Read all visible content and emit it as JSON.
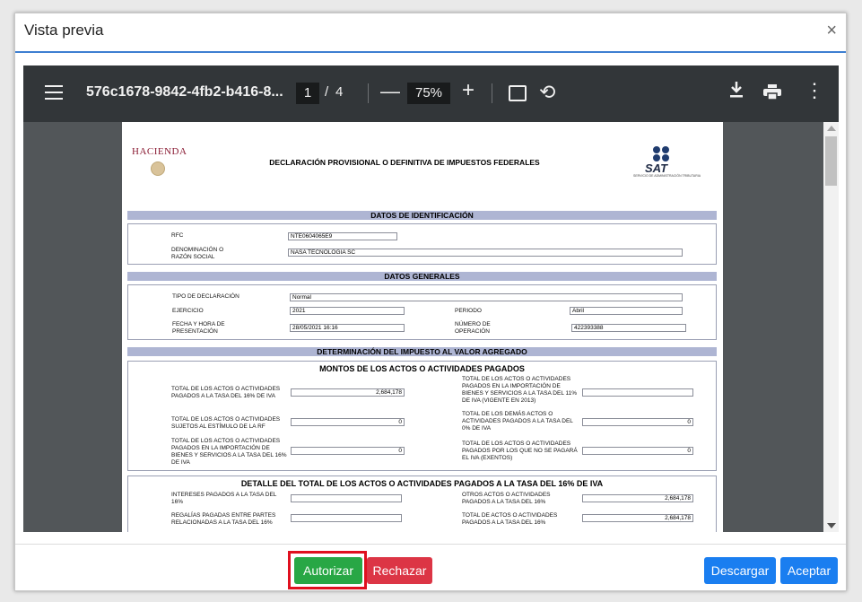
{
  "modal": {
    "title": "Vista previa",
    "close": "×"
  },
  "viewer": {
    "filename": "576c1678-9842-4fb2-b416-8...",
    "page_current": "1",
    "page_separator": "/",
    "page_total": "4",
    "zoom": "75%"
  },
  "document": {
    "logo_text": "HACIENDA",
    "title": "DECLARACIÓN PROVISIONAL O DEFINITIVA DE IMPUESTOS FEDERALES",
    "sat_logo": "SAT",
    "sat_sub": "SERVICIO DE ADMINISTRACIÓN TRIBUTARIA",
    "sec_identificacion": "DATOS DE IDENTIFICACIÓN",
    "rfc_label": "RFC",
    "rfc_value": "NTE0604065E9",
    "razon_label_1": "DENOMINACIÓN O",
    "razon_label_2": "RAZÓN SOCIAL",
    "razon_value": "NASA TECNOLOGIA SC",
    "sec_generales": "DATOS GENERALES",
    "tipo_label": "TIPO DE DECLARACIÓN",
    "tipo_value": "Normal",
    "ejercicio_label": "EJERCICIO",
    "ejercicio_value": "2021",
    "periodo_label": "PERIODO",
    "periodo_value": "Abril",
    "fecha_label_1": "FECHA Y HORA DE",
    "fecha_label_2": "PRESENTACIÓN",
    "fecha_value": "28/05/2021 16:16",
    "operacion_label_1": "NÚMERO DE",
    "operacion_label_2": "OPERACIÓN",
    "operacion_value": "422393388",
    "sec_iva": "DETERMINACIÓN DEL IMPUESTO AL VALOR AGREGADO",
    "montos_head": "MONTOS DE LOS ACTOS O ACTIVIDADES PAGADOS",
    "m1_label_1": "TOTAL DE LOS ACTOS O ACTIVIDADES",
    "m1_label_2": "PAGADOS A LA TASA DEL 16% DE IVA",
    "m1_value": "2,684,178",
    "m2_label_1": "TOTAL DE LOS ACTOS O ACTIVIDADES",
    "m2_label_2": "PAGADOS EN LA IMPORTACIÓN DE",
    "m2_label_3": "BIENES Y SERVICIOS A LA TASA DEL 11%",
    "m2_label_4": "DE IVA (VIGENTE EN 2013)",
    "m3_label_1": "TOTAL DE LOS ACTOS O ACTIVIDADES",
    "m3_label_2": "SUJETOS AL ESTÍMULO DE LA RF",
    "m3_value": "0",
    "m4_label_1": "TOTAL DE LOS DEMÁS ACTOS O",
    "m4_label_2": "ACTIVIDADES PAGADOS A LA TASA DEL",
    "m4_label_3": "0% DE IVA",
    "m4_value": "0",
    "m5_label_1": "TOTAL DE LOS ACTOS O ACTIVIDADES",
    "m5_label_2": "PAGADOS EN LA IMPORTACIÓN DE",
    "m5_label_3": "BIENES Y SERVICIOS A LA TASA DEL 16%",
    "m5_label_4": "DE IVA",
    "m5_value": "0",
    "m6_label_1": "TOTAL DE LOS ACTOS O ACTIVIDADES",
    "m6_label_2": "PAGADOS POR LOS QUE NO SE PAGARÁ",
    "m6_label_3": "EL IVA (EXENTOS)",
    "m6_value": "0",
    "detalle_head": "DETALLE DEL TOTAL DE LOS ACTOS O ACTIVIDADES PAGADOS A LA TASA DEL 16% DE IVA",
    "d1_label_1": "INTERESES PAGADOS A LA TASA DEL",
    "d1_label_2": "16%",
    "d2_label_1": "OTROS ACTOS O ACTIVIDADES",
    "d2_label_2": "PAGADOS A LA TASA DEL 16%",
    "d2_value": "2,684,178",
    "d3_label_1": "REGALÍAS PAGADAS ENTRE PARTES",
    "d3_label_2": "RELACIONADAS A LA TASA DEL 16%",
    "d4_label_1": "TOTAL DE ACTOS O ACTIVIDADES",
    "d4_label_2": "PAGADOS A LA TASA DEL 16%",
    "d4_value": "2,684,178"
  },
  "footer": {
    "autorizar": "Autorizar",
    "rechazar": "Rechazar",
    "descargar": "Descargar",
    "aceptar": "Aceptar"
  },
  "colors": {
    "toolbar": "#323639",
    "section_bar": "#aeb5d3",
    "success": "#28a745",
    "danger": "#dc3545",
    "primary": "#1a7ef0",
    "highlight": "#e0101f"
  },
  "icons": [
    "menu-icon",
    "minus-icon",
    "plus-icon",
    "fit-page-icon",
    "rotate-icon",
    "download-icon",
    "print-icon",
    "more-vert-icon",
    "close-icon"
  ]
}
